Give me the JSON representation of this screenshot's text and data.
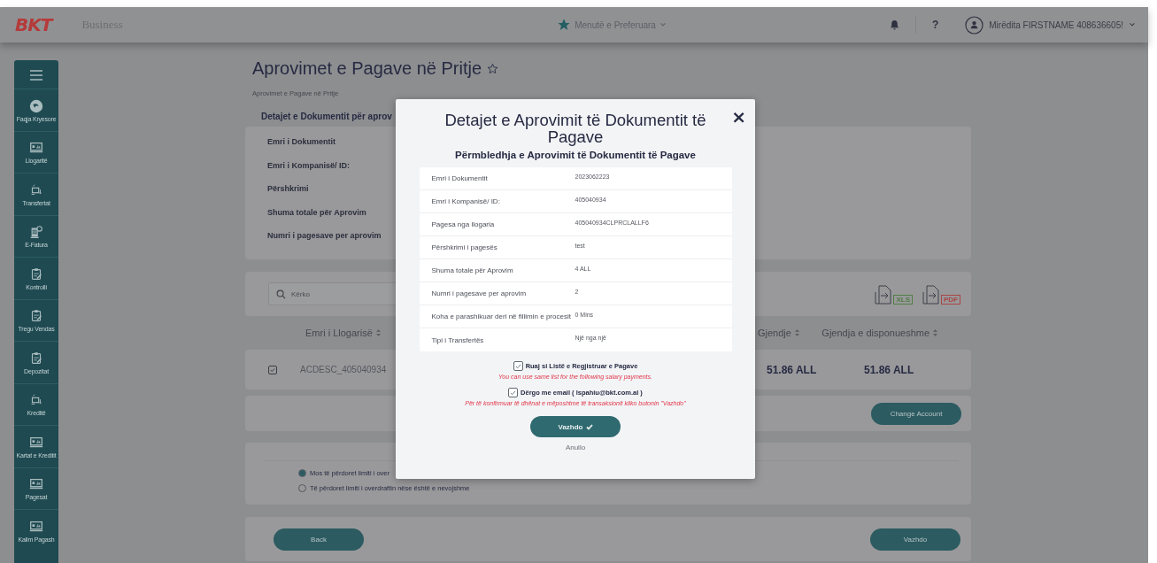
{
  "header": {
    "logo": "BKT",
    "brand": "Business",
    "favorites": "Menutë e Preferuara",
    "help": "?",
    "user": "Mirëdita FIRSTNAME 408636605!"
  },
  "sidebar": {
    "items": [
      {
        "label": "Faqja Kryesore",
        "kind": "home"
      },
      {
        "label": "Llogaritë",
        "kind": "monitor"
      },
      {
        "label": "Transfertat",
        "kind": "transfer"
      },
      {
        "label": "E-Fatura",
        "kind": "invoice"
      },
      {
        "label": "Kontrolli",
        "kind": "clipboard"
      },
      {
        "label": "Tregu Vendas",
        "kind": "clipboard"
      },
      {
        "label": "Depozitat",
        "kind": "clipboard"
      },
      {
        "label": "Kreditë",
        "kind": "transfer"
      },
      {
        "label": "Kartat e Kreditit",
        "kind": "monitor"
      },
      {
        "label": "Pagesat",
        "kind": "monitor"
      },
      {
        "label": "Kalim Pagash",
        "kind": "monitor"
      }
    ]
  },
  "page": {
    "title": "Aprovimet e Pagave në Pritje",
    "breadcrumb": "Aprovimet e Pagave në Pritje",
    "section_title": "Detajet e Dokumentit për aprov",
    "detail_labels": [
      "Emri i Dokumentit",
      "Emri i Kompanisë/ ID:",
      "Përshkrimi",
      "Shuma totale për Aprovim",
      "Numri i pagesave per aprovim"
    ],
    "search": {
      "placeholder": "Kërko"
    },
    "exports": [
      {
        "label": "XLS",
        "color": "#4f7d43"
      },
      {
        "label": "PDF",
        "color": "#a84545"
      }
    ],
    "columns": [
      "Emri i Llogarisë",
      "Gjendje",
      "Gjendja e disponueshme"
    ],
    "rows": [
      {
        "checked": true,
        "account": "ACDESC_405040934",
        "balance": "51.86 ALL",
        "available": "51.86 ALL"
      }
    ],
    "change_account": "Change Account",
    "overdraft_options": [
      {
        "label": "Mos të përdoret limiti i over",
        "selected": true
      },
      {
        "label": "Të përdoret limiti i overdraftin nëse është e nevojshme",
        "selected": false
      }
    ],
    "back": "Back",
    "continue": "Vazhdo"
  },
  "modal": {
    "title": "Detajet e Aprovimit të Dokumentit të Pagave",
    "close": "×",
    "subtitle": "Përmbledhja e Aprovimit të Dokumentit të Pagave",
    "fields": [
      {
        "label": "Emri i Dokumentit",
        "value": "2023062223"
      },
      {
        "label": "Emri i Kompanisë/ ID:",
        "value": "405040934"
      },
      {
        "label": "Pagesa nga llogaria",
        "value": "405040934CLPRCLALLF6"
      },
      {
        "label": "Përshkrimi i pagesës",
        "value": "test"
      },
      {
        "label": "Shuma totale për Aprovim",
        "value": "4 ALL"
      },
      {
        "label": "Numri i pagesave per aprovim",
        "value": "2"
      },
      {
        "label": "Koha e parashikuar deri në fillimin e procesit",
        "value": "0 Mins"
      },
      {
        "label": "Tipi i Transfertës",
        "value": "Një nga një"
      }
    ],
    "options": [
      {
        "label": "Ruaj si Listë e Regjistruar e Pagave",
        "checked": true,
        "note": "You can use same list for the following salary payments."
      },
      {
        "label": "Dërgo me email ( lspahiu@bkt.com.al )",
        "checked": true,
        "note": "Për të konfirmuar të dhënat e mëposhtme të transaksionit kliko butonin \"Vazhdo\""
      }
    ],
    "confirm": "Vazhdo",
    "cancel": "Anullo"
  }
}
